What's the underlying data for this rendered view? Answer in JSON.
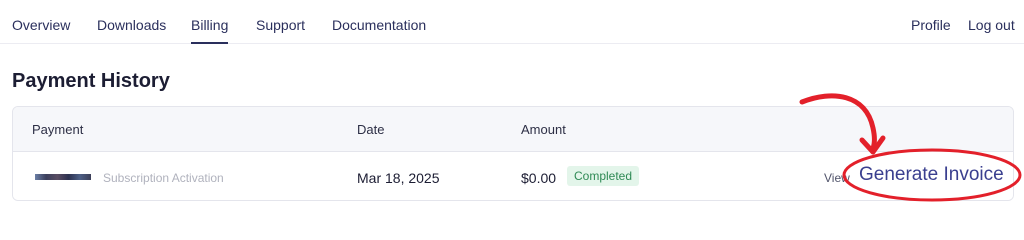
{
  "nav": {
    "left": [
      "Overview",
      "Downloads",
      "Billing",
      "Support",
      "Documentation"
    ],
    "active": "Billing",
    "right": [
      "Profile",
      "Log out"
    ]
  },
  "page": {
    "title": "Payment History"
  },
  "table": {
    "columns": [
      "Payment",
      "Date",
      "Amount"
    ],
    "rows": [
      {
        "payment_desc": "Subscription Activation",
        "date": "Mar 18, 2025",
        "amount": "$0.00",
        "status": "Completed",
        "view_label": "View",
        "generate_label": "Generate Invoice"
      }
    ]
  },
  "colors": {
    "annotation_red": "#e3202a",
    "status_green": "#2f8a55",
    "nav_text": "#2a2f5c"
  }
}
